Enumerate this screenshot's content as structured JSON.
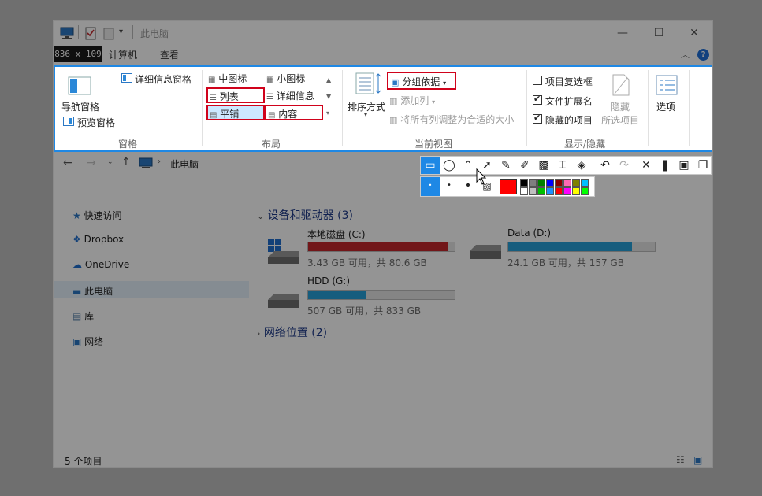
{
  "window": {
    "title": "此电脑",
    "minimize": "—",
    "maximize": "☐",
    "close": "✕"
  },
  "capture": {
    "size": "836 x 109"
  },
  "tabs": [
    {
      "label": "计算机"
    },
    {
      "label": "查看"
    }
  ],
  "ribbon": {
    "panes": {
      "nav_pane": "导航窗格",
      "preview_pane": "预览窗格",
      "details_pane": "详细信息窗格",
      "title": "窗格"
    },
    "layout": {
      "medium_icons": "中图标",
      "small_icons": "小图标",
      "list": "列表",
      "details": "详细信息",
      "tiles": "平铺",
      "content": "内容",
      "title": "布局"
    },
    "current_view": {
      "sort_by": "排序方式",
      "group_by": "分组依据",
      "add_column": "添加列",
      "fit_columns": "将所有列调整为合适的大小",
      "title": "当前视图"
    },
    "show_hide": {
      "item_checkboxes": "项目复选框",
      "file_extensions": "文件扩展名",
      "hidden_items": "隐藏的项目",
      "hide": "隐藏",
      "selected_items": "所选项目",
      "title": "显示/隐藏"
    },
    "options": "选项"
  },
  "address": {
    "location": "此电脑"
  },
  "nav": [
    {
      "label": "快速访问"
    },
    {
      "label": "Dropbox"
    },
    {
      "label": "OneDrive"
    },
    {
      "label": "此电脑"
    },
    {
      "label": "库"
    },
    {
      "label": "网络"
    }
  ],
  "content": {
    "devices_header": "设备和驱动器 (3)",
    "network_header": "网络位置 (2)",
    "drives": [
      {
        "name": "本地磁盘 (C:)",
        "space": "3.43 GB 可用，共 80.6 GB",
        "used": 0.957,
        "color": "#c4262c"
      },
      {
        "name": "Data (D:)",
        "space": "24.1 GB 可用，共 157 GB",
        "used": 0.846,
        "color": "#26a0da"
      },
      {
        "name": "HDD (G:)",
        "space": "507 GB 可用，共 833 GB",
        "used": 0.391,
        "color": "#26a0da"
      }
    ]
  },
  "status": {
    "items": "5 个项目"
  },
  "colors": {
    "accent": "#1e88e5",
    "highlight_red": "#d0021b",
    "selected_color": "#ff0000"
  }
}
